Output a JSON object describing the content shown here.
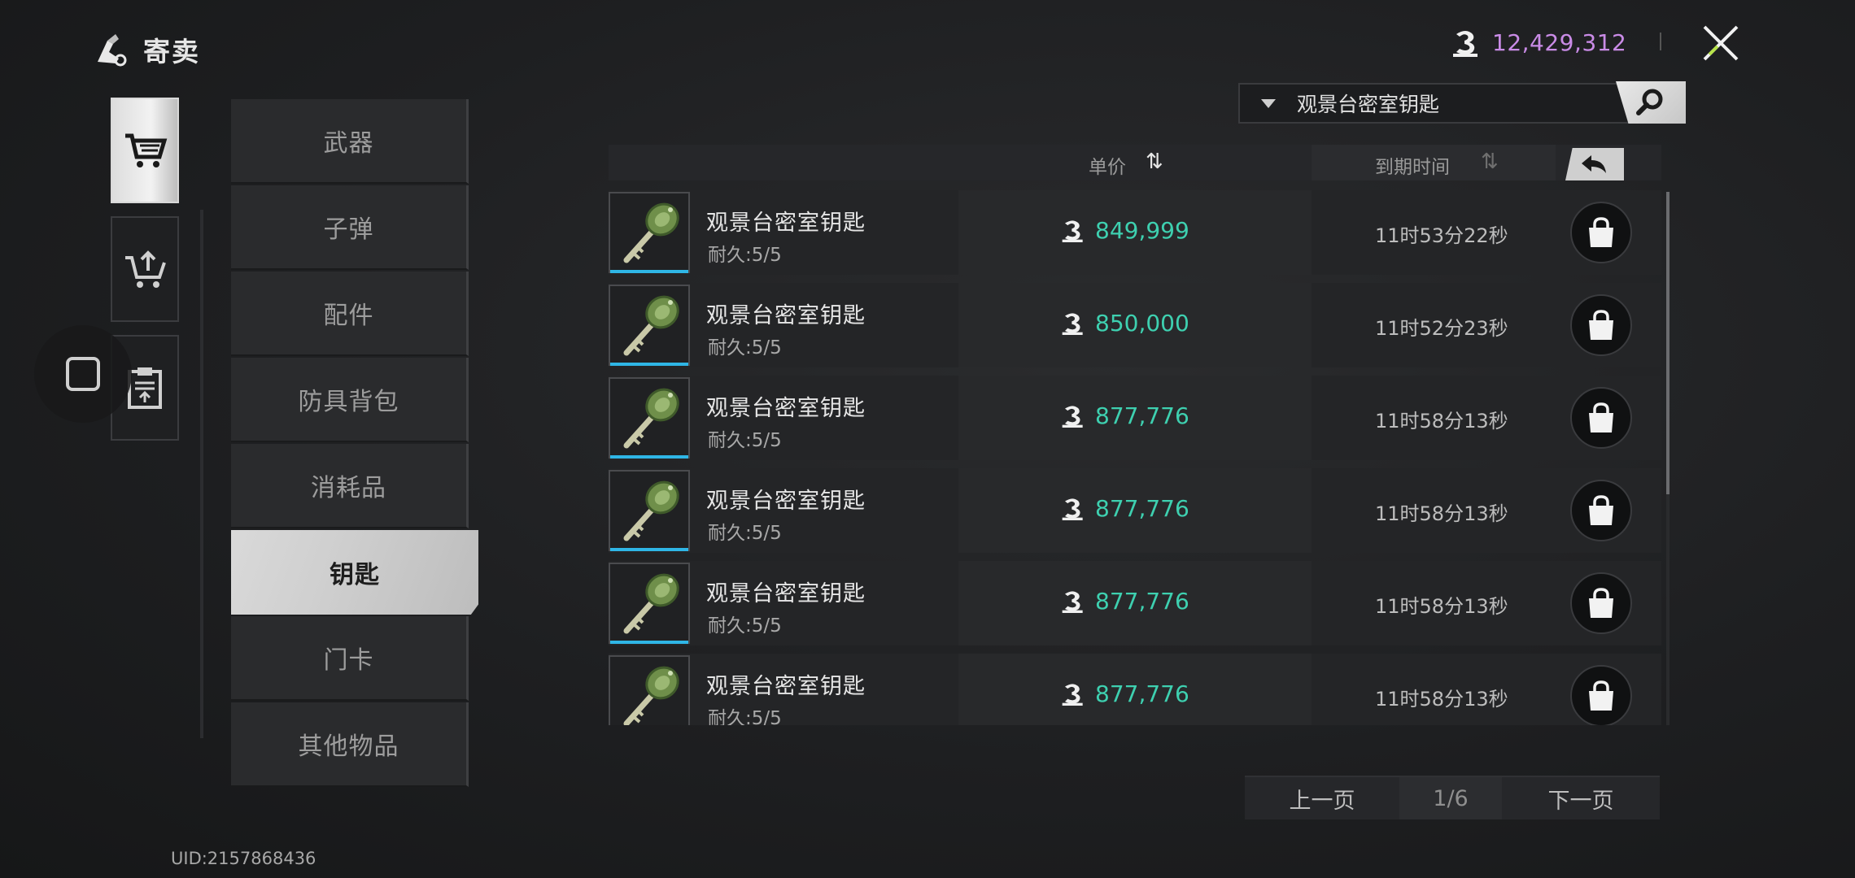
{
  "header": {
    "title": "寄卖",
    "currency_amount": "12,429,312"
  },
  "search": {
    "value": "观景台密室钥匙"
  },
  "side_tabs": [
    {
      "name": "buy",
      "active": true
    },
    {
      "name": "sell",
      "active": false
    },
    {
      "name": "records",
      "active": false
    }
  ],
  "categories": [
    {
      "label": "武器",
      "active": false
    },
    {
      "label": "子弹",
      "active": false
    },
    {
      "label": "配件",
      "active": false
    },
    {
      "label": "防具背包",
      "active": false
    },
    {
      "label": "消耗品",
      "active": false
    },
    {
      "label": "钥匙",
      "active": true
    },
    {
      "label": "门卡",
      "active": false
    },
    {
      "label": "其他物品",
      "active": false
    }
  ],
  "list": {
    "price_header": "单价",
    "expire_header": "到期时间",
    "rows": [
      {
        "name": "观景台密室钥匙",
        "durability": "耐久:5/5",
        "price": "849,999",
        "time": "11时53分22秒"
      },
      {
        "name": "观景台密室钥匙",
        "durability": "耐久:5/5",
        "price": "850,000",
        "time": "11时52分23秒"
      },
      {
        "name": "观景台密室钥匙",
        "durability": "耐久:5/5",
        "price": "877,776",
        "time": "11时58分13秒"
      },
      {
        "name": "观景台密室钥匙",
        "durability": "耐久:5/5",
        "price": "877,776",
        "time": "11时58分13秒"
      },
      {
        "name": "观景台密室钥匙",
        "durability": "耐久:5/5",
        "price": "877,776",
        "time": "11时58分13秒"
      },
      {
        "name": "观景台密室钥匙",
        "durability": "耐久:5/5",
        "price": "877,776",
        "time": "11时58分13秒"
      }
    ]
  },
  "pagination": {
    "prev_label": "上一页",
    "page": "1/6",
    "next_label": "下一页"
  },
  "uid": "UID:2157868436",
  "colors": {
    "currency": "#c98be6",
    "price": "#3ed0b0",
    "rarity_bar": "#2fb6e6"
  }
}
